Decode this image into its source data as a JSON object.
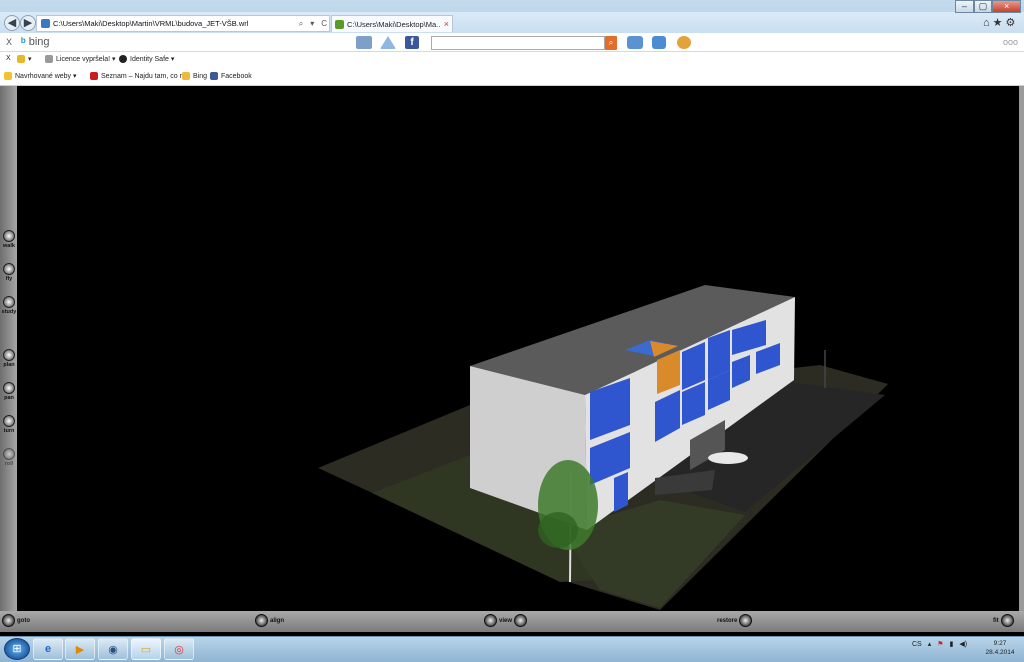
{
  "browser": {
    "address_url": "C:\\Users\\Maki\\Desktop\\Martin\\VRML\\budova_JET-VŠB.wrl",
    "address_controls": [
      "⌕",
      "▾",
      "C",
      "×"
    ],
    "tab_title": "C:\\Users\\Maki\\Desktop\\Ma...",
    "tab_close": "×",
    "window_controls": [
      "–",
      "▢",
      "×"
    ],
    "corner_icons": [
      "home-icon",
      "star-icon",
      "gear-icon"
    ]
  },
  "bingbar": {
    "close": "X",
    "logo": "bing",
    "icons": [
      "mail-icon",
      "envelope-icon",
      "facebook-icon",
      "like-icon",
      "chat-icon",
      "puzzle-icon"
    ],
    "search_placeholder": "",
    "more": "ooo"
  },
  "toolbar2": {
    "close": "X",
    "items": [
      {
        "label": "▾",
        "icon": "check-icon"
      },
      {
        "label": "Licence vypršela! ▾",
        "icon": "security-icon"
      },
      {
        "label": "Identity Safe ▾",
        "icon": "identity-icon"
      }
    ]
  },
  "favorites": [
    {
      "label": "Navrhované weby ▾",
      "icon": "star-icon"
    },
    {
      "label": "Seznam – Najdu tam, co n...",
      "icon": "seznam-icon"
    },
    {
      "label": "Bing",
      "icon": "bing-icon"
    },
    {
      "label": "Facebook",
      "icon": "facebook-icon"
    }
  ],
  "viewer": {
    "nav_modes": [
      {
        "label": "walk"
      },
      {
        "label": "fly"
      },
      {
        "label": "study"
      },
      {
        "label": "plan"
      },
      {
        "label": "pan"
      },
      {
        "label": "turn"
      },
      {
        "label": "roll"
      }
    ],
    "bottom_controls": [
      {
        "label": "goto"
      },
      {
        "label": "align"
      },
      {
        "label": "view"
      },
      {
        "label": "restore"
      },
      {
        "label": "fit"
      }
    ]
  },
  "taskbar": {
    "apps": [
      "internet-explorer-icon",
      "media-player-icon",
      "network-icon",
      "explorer-folder-icon",
      "chrome-icon"
    ],
    "language": "CS",
    "time": "9:27",
    "date": "28.4.2014"
  },
  "colors": {
    "viewer_bg": "#000000",
    "window_glass": "#3355cc",
    "building_wall": "#cfcfcf",
    "roof": "#5a5a5a",
    "ground": "#2f2f22"
  }
}
